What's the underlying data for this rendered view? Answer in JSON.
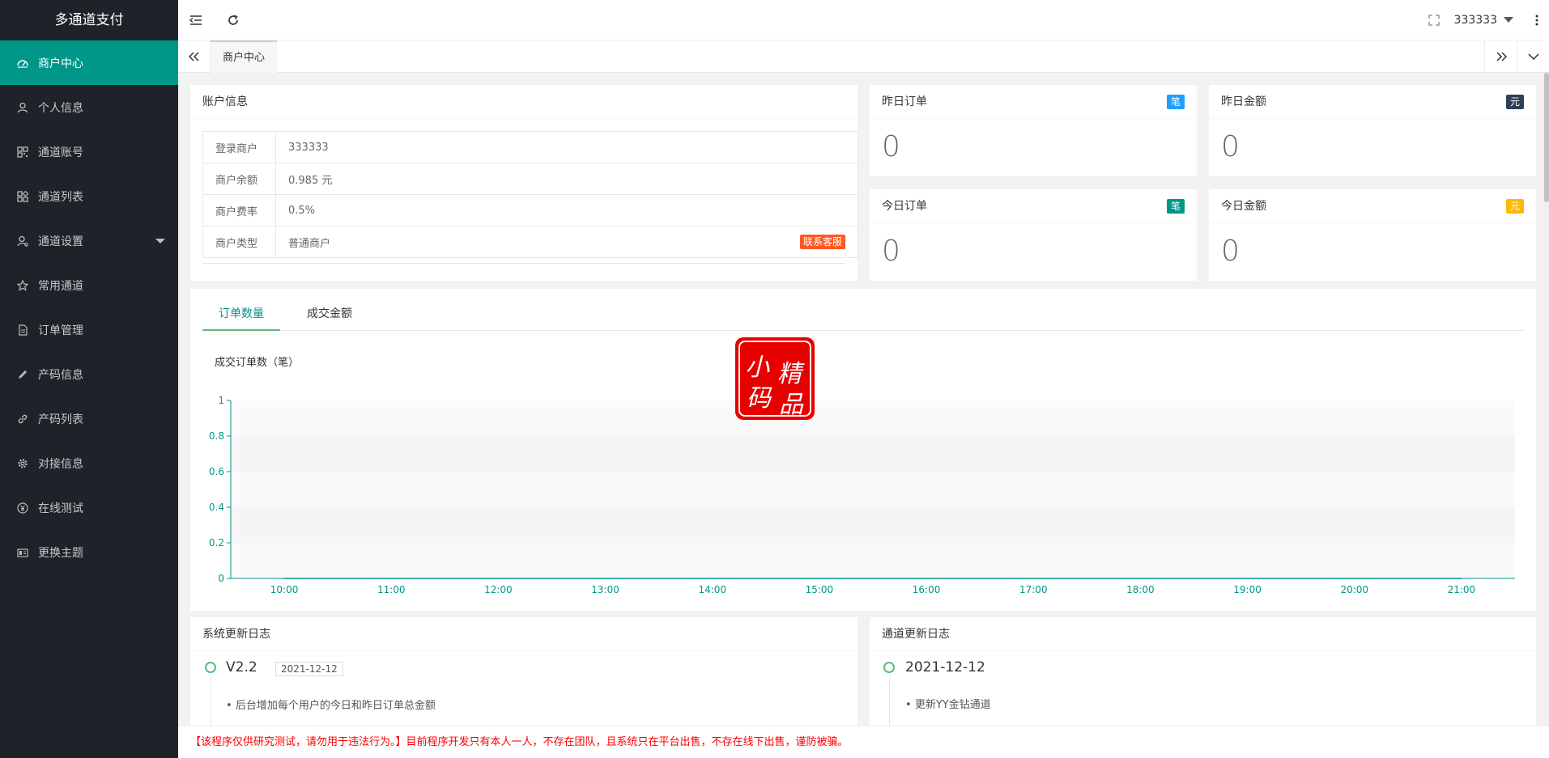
{
  "app": {
    "title": "多通道支付"
  },
  "sidebar": {
    "items": [
      {
        "label": "商户中心",
        "icon": "dashboard-icon",
        "active": true
      },
      {
        "label": "个人信息",
        "icon": "user-icon"
      },
      {
        "label": "通道账号",
        "icon": "grid-icon"
      },
      {
        "label": "通道列表",
        "icon": "apps-icon"
      },
      {
        "label": "通道设置",
        "icon": "user-settings-icon",
        "has_submenu": true
      },
      {
        "label": "常用通道",
        "icon": "star-icon"
      },
      {
        "label": "订单管理",
        "icon": "document-icon"
      },
      {
        "label": "产码信息",
        "icon": "pencil-icon"
      },
      {
        "label": "产码列表",
        "icon": "link-icon"
      },
      {
        "label": "对接信息",
        "icon": "gear-icon"
      },
      {
        "label": "在线测试",
        "icon": "yen-icon"
      },
      {
        "label": "更换主题",
        "icon": "theme-icon"
      }
    ]
  },
  "header": {
    "username": "333333"
  },
  "tabs": {
    "current": "商户中心"
  },
  "account": {
    "title": "账户信息",
    "rows": [
      {
        "key": "登录商户",
        "value": "333333"
      },
      {
        "key": "商户余额",
        "value": "0.985 元"
      },
      {
        "key": "商户费率",
        "value": "0.5%"
      },
      {
        "key": "商户类型",
        "value": "普通商户"
      }
    ],
    "contact_button": "联系客服"
  },
  "stats": [
    {
      "title": "昨日订单",
      "badge": "笔",
      "badge_color": "#1e9fff",
      "value": "0"
    },
    {
      "title": "昨日金额",
      "badge": "元",
      "badge_color": "#2f4056",
      "value": "0"
    },
    {
      "title": "今日订单",
      "badge": "笔",
      "badge_color": "#009688",
      "value": "0"
    },
    {
      "title": "今日金额",
      "badge": "元",
      "badge_color": "#ffb800",
      "value": "0"
    }
  ],
  "chart_tabs": [
    "订单数量",
    "成交金额"
  ],
  "chart_data": {
    "type": "line",
    "title": "成交订单数（笔）",
    "x": [
      "10:00",
      "11:00",
      "12:00",
      "13:00",
      "14:00",
      "15:00",
      "16:00",
      "17:00",
      "18:00",
      "19:00",
      "20:00",
      "21:00"
    ],
    "series": [
      {
        "values": [
          0,
          0,
          0,
          0,
          0,
          0,
          0,
          0,
          0,
          0,
          0,
          0
        ]
      }
    ],
    "yticks": [
      "0",
      "0.2",
      "0.4",
      "0.6",
      "0.8",
      "1"
    ],
    "ylim": [
      0,
      1
    ],
    "color": "#009688"
  },
  "watermark": {
    "text": "小码精品",
    "color": "#e60000"
  },
  "system_log": {
    "title": "系统更新日志",
    "version": "V2.2",
    "date": "2021-12-12",
    "items": [
      "后台增加每个用户的今日和昨日订单总金额"
    ]
  },
  "channel_log": {
    "title": "通道更新日志",
    "date": "2021-12-12",
    "items": [
      "更新YY金钻通道"
    ]
  },
  "footer": {
    "notice": "【该程序仅供研究测试，请勿用于违法行为。】目前程序开发只有本人一人，不存在团队，且系统只在平台出售，不存在线下出售，谨防被骗。"
  }
}
